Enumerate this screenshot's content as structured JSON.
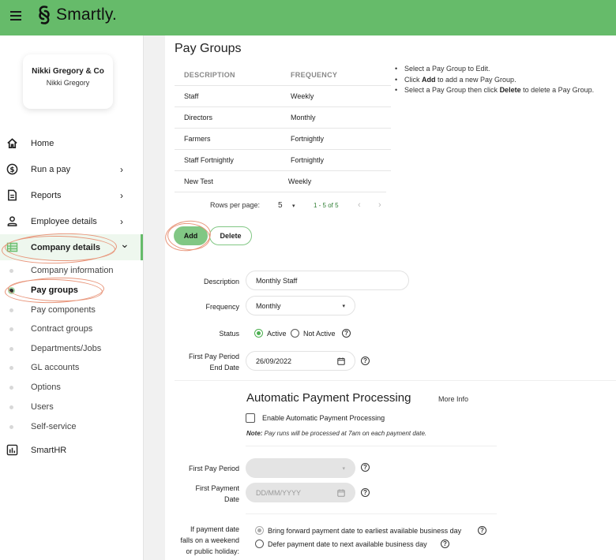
{
  "app": {
    "brand": "Smartly.",
    "brand_color": "#66bb6a"
  },
  "icons": {
    "menu": "hamburger-icon",
    "logo": "smartly-logo-icon",
    "home": "home-icon",
    "run_pay": "dollar-circle-icon",
    "reports": "document-icon",
    "employee": "person-icon",
    "company": "table-grid-icon",
    "smarthr": "bar-chart-icon",
    "help": "question-circle-icon",
    "calendar": "calendar-icon"
  },
  "company_card": {
    "company_name": "Nikki Gregory & Co",
    "user_name": "Nikki Gregory"
  },
  "sidebar": {
    "items": [
      {
        "label": "Home",
        "chevron": ""
      },
      {
        "label": "Run a pay",
        "chevron": "›"
      },
      {
        "label": "Reports",
        "chevron": "›"
      },
      {
        "label": "Employee details",
        "chevron": "›"
      },
      {
        "label": "Company details",
        "chevron": "⌄",
        "active": true
      }
    ],
    "sub_items": [
      {
        "label": "Company information"
      },
      {
        "label": "Pay groups",
        "active": true
      },
      {
        "label": "Pay components"
      },
      {
        "label": "Contract groups"
      },
      {
        "label": "Departments/Jobs"
      },
      {
        "label": "GL accounts"
      },
      {
        "label": "Options"
      },
      {
        "label": "Users"
      },
      {
        "label": "Self-service"
      }
    ],
    "bottom_item": {
      "label": "SmartHR"
    }
  },
  "main": {
    "title": "Pay Groups",
    "table": {
      "headers": [
        "DESCRIPTION",
        "FREQUENCY"
      ],
      "rows": [
        [
          "Staff",
          "Weekly"
        ],
        [
          "Directors",
          "Monthly"
        ],
        [
          "Farmers",
          "Fortnightly"
        ],
        [
          "Staff Fortnightly",
          "Fortnightly"
        ],
        [
          "New Test",
          "Weekly"
        ]
      ]
    },
    "pagination": {
      "rows_per_page_label": "Rows per page:",
      "rows_per_page_value": "5",
      "caret": "▾",
      "range": "1 - 5 of 5",
      "prev": "‹",
      "next": "›"
    },
    "help": {
      "line1": "Select a Pay Group to Edit.",
      "line2_pre": "Click ",
      "line2_bold": "Add",
      "line2_post": " to add a new Pay Group.",
      "line3_pre": "Select a Pay Group then click ",
      "line3_bold": "Delete",
      "line3_post": " to delete a Pay Group."
    },
    "buttons": {
      "add": "Add",
      "delete": "Delete"
    },
    "form": {
      "description_label": "Description",
      "description_value": "Monthly Staff",
      "frequency_label": "Frequency",
      "frequency_value": "Monthly",
      "status_label": "Status",
      "status_active": "Active",
      "status_not_active": "Not Active",
      "status_selected": "Active",
      "first_pay_end_label_1": "First Pay Period",
      "first_pay_end_label_2": "End Date",
      "first_pay_end_value": "26/09/2022",
      "help_glyph": "?",
      "caret": "▾"
    },
    "auto_payment": {
      "title": "Automatic Payment Processing",
      "more_info": "More Info",
      "checkbox_label": "Enable Automatic Payment Processing",
      "checkbox_checked": false,
      "note_bold": "Note:",
      "note_text": " Pay runs will be processed at 7am on each payment date.",
      "first_pay_period_label": "First Pay Period",
      "first_pay_period_value": "",
      "first_payment_date_label_1": "First Payment",
      "first_payment_date_label_2": "Date",
      "first_payment_date_placeholder": "DD/MM/YYYY",
      "weekend_label_1": "If payment date",
      "weekend_label_2": "falls on a weekend",
      "weekend_label_3": "or public holiday:",
      "option_forward": "Bring forward payment date to earliest available business day",
      "option_defer": "Defer payment date to next available business day",
      "selected_option": "forward"
    }
  }
}
